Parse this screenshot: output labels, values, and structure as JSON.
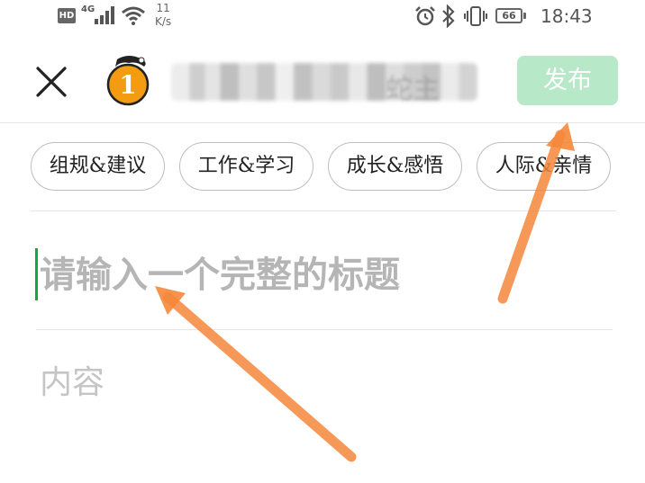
{
  "status_bar": {
    "hd": "HD",
    "network": "4G",
    "speed_value": "11",
    "speed_unit": "K/s",
    "battery": "66",
    "time": "18:43"
  },
  "header": {
    "avatar_badge": "1",
    "username_suffix": "蛇主",
    "publish_label": "发布"
  },
  "tags": [
    "组规&建议",
    "工作&学习",
    "成长&感悟",
    "人际&亲情"
  ],
  "title_input": {
    "placeholder": "请输入一个完整的标题"
  },
  "content_input": {
    "placeholder": "内容"
  },
  "colors": {
    "accent_green": "#12a84a",
    "publish_disabled": "#b7e8c7",
    "arrow": "#f5873a"
  },
  "icons": [
    "close-icon",
    "signal-icon",
    "wifi-icon",
    "alarm-icon",
    "bluetooth-icon",
    "vibrate-icon",
    "battery-icon"
  ]
}
